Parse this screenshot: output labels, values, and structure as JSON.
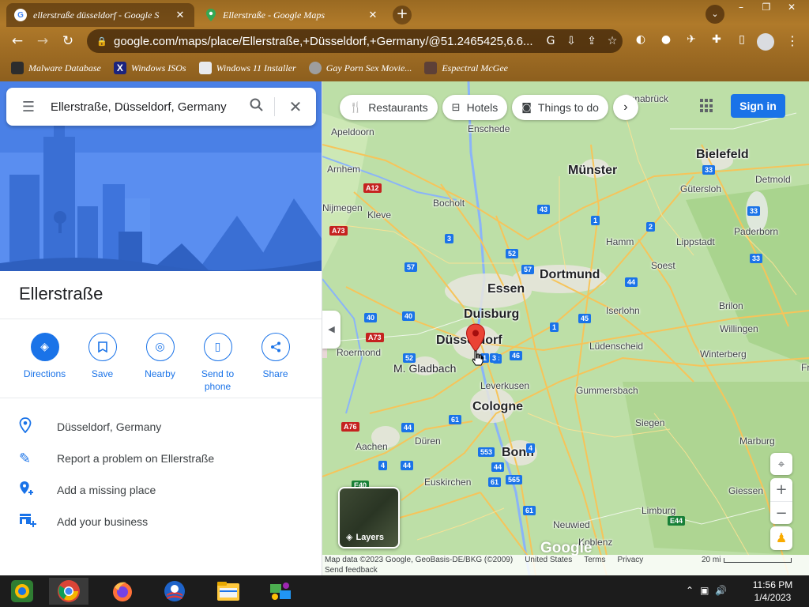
{
  "browser": {
    "tabs": [
      {
        "title": "ellerstraße düsseldorf - Google S",
        "active": true
      },
      {
        "title": "Ellerstraße - Google Maps",
        "active": false
      }
    ],
    "url": "google.com/maps/place/Ellerstraße,+Düsseldorf,+Germany/@51.2465425,6.6...",
    "bookmarks": [
      {
        "label": "Malware Database",
        "icon": "malware-icon"
      },
      {
        "label": "Windows ISOs",
        "icon": "x-icon"
      },
      {
        "label": "Windows 11 Installer",
        "icon": "windows-icon"
      },
      {
        "label": "Gay Porn Sex Movie...",
        "icon": "site-icon"
      },
      {
        "label": "Espectral McGee",
        "icon": "bookmark-icon"
      }
    ]
  },
  "panel": {
    "search_query": "Ellerstraße, Düsseldorf, Germany",
    "place_title": "Ellerstraße",
    "actions": [
      {
        "label": "Directions",
        "icon": "directions-icon"
      },
      {
        "label": "Save",
        "icon": "bookmark-icon"
      },
      {
        "label": "Nearby",
        "icon": "nearby-icon"
      },
      {
        "label": "Send to phone",
        "icon": "phone-icon"
      },
      {
        "label": "Share",
        "icon": "share-icon"
      }
    ],
    "info": [
      {
        "text": "Düsseldorf, Germany",
        "icon": "location-pin-icon"
      },
      {
        "text": "Report a problem on Ellerstraße",
        "icon": "pencil-icon"
      },
      {
        "text": "Add a missing place",
        "icon": "add-place-icon"
      },
      {
        "text": "Add your business",
        "icon": "add-business-icon"
      }
    ]
  },
  "map": {
    "chips": [
      "Restaurants",
      "Hotels",
      "Things to do"
    ],
    "signin": "Sign in",
    "layers": "Layers",
    "logo": "Google",
    "cities": [
      {
        "name": "Düsseldorf",
        "size": "big"
      },
      {
        "name": "Duisburg",
        "size": "big"
      },
      {
        "name": "Essen",
        "size": "big"
      },
      {
        "name": "Dortmund",
        "size": "big"
      },
      {
        "name": "Cologne",
        "size": "big"
      },
      {
        "name": "Bonn",
        "size": "big"
      },
      {
        "name": "Münster",
        "size": "big"
      },
      {
        "name": "Bielefeld",
        "size": "big"
      },
      {
        "name": "M. Gladbach",
        "size": "mid"
      },
      {
        "name": "Apeldoorn",
        "size": "sm"
      },
      {
        "name": "Enschede",
        "size": "sm"
      },
      {
        "name": "Arnhem",
        "size": "sm"
      },
      {
        "name": "Bocholt",
        "size": "sm"
      },
      {
        "name": "Kleve",
        "size": "sm"
      },
      {
        "name": "Nijmegen",
        "size": "sm"
      },
      {
        "name": "Hamm",
        "size": "sm"
      },
      {
        "name": "Gütersloh",
        "size": "sm"
      },
      {
        "name": "Detmold",
        "size": "sm"
      },
      {
        "name": "Lippstadt",
        "size": "sm"
      },
      {
        "name": "Paderborn",
        "size": "sm"
      },
      {
        "name": "Soest",
        "size": "sm"
      },
      {
        "name": "Iserlohn",
        "size": "sm"
      },
      {
        "name": "Brilon",
        "size": "sm"
      },
      {
        "name": "Willingen",
        "size": "sm"
      },
      {
        "name": "Winterberg",
        "size": "sm"
      },
      {
        "name": "Lüdenscheid",
        "size": "sm"
      },
      {
        "name": "Roermond",
        "size": "sm"
      },
      {
        "name": "Leverkusen",
        "size": "sm"
      },
      {
        "name": "Gummersbach",
        "size": "sm"
      },
      {
        "name": "Siegen",
        "size": "sm"
      },
      {
        "name": "Marburg",
        "size": "sm"
      },
      {
        "name": "Aachen",
        "size": "sm"
      },
      {
        "name": "Düren",
        "size": "sm"
      },
      {
        "name": "Euskirchen",
        "size": "sm"
      },
      {
        "name": "Giessen",
        "size": "sm"
      },
      {
        "name": "Neuwied",
        "size": "sm"
      },
      {
        "name": "Koblenz",
        "size": "sm"
      },
      {
        "name": "Limburg",
        "size": "sm"
      },
      {
        "name": "Frankenberg",
        "size": "sm"
      },
      {
        "name": "Osnabrück",
        "size": "sm"
      }
    ],
    "roads": [
      "A12",
      "A73",
      "A76",
      "A73",
      "E40",
      "E44",
      "3",
      "3",
      "1",
      "1",
      "2",
      "33",
      "33",
      "33",
      "43",
      "44",
      "44",
      "45",
      "46",
      "52",
      "52",
      "57",
      "57",
      "40",
      "40",
      "61",
      "61",
      "61",
      "44",
      "4",
      "44",
      "553",
      "565",
      "1",
      "3",
      "4"
    ],
    "attribution": {
      "map_data": "Map data ©2023 Google, GeoBasis-DE/BKG (©2009)",
      "united_states": "United States",
      "terms": "Terms",
      "privacy": "Privacy",
      "send_feedback": "Send feedback",
      "scale": "20 mi"
    }
  },
  "taskbar": {
    "time": "11:56 PM",
    "date": "1/4/2023"
  }
}
